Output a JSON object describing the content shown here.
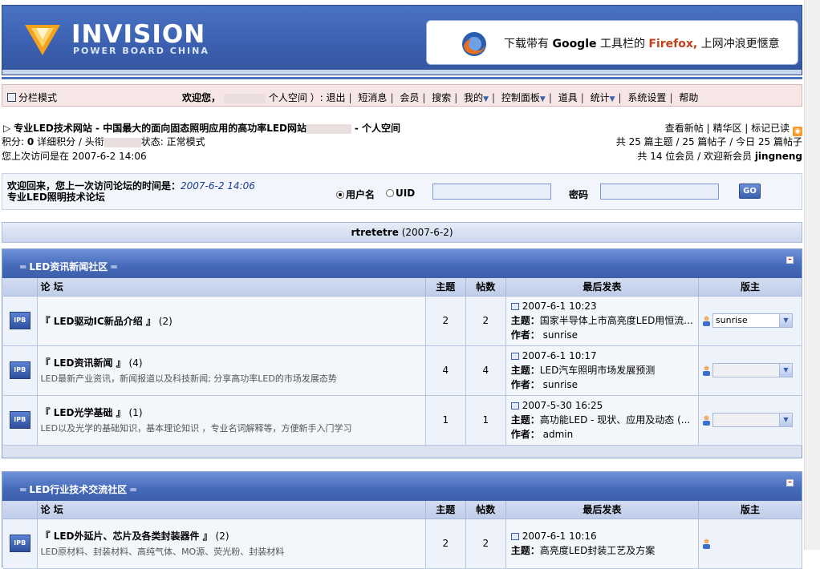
{
  "header": {
    "logo_title": "INVISION",
    "logo_sub": "POWER BOARD CHINA",
    "banner": {
      "pre": "下载带有 ",
      "google": "Google",
      "mid": " 工具栏的 ",
      "firefox": "Firefox,",
      "post": " 上网冲浪更惬意"
    }
  },
  "userbar": {
    "view_mode": "分栏模式",
    "welcome": "欢迎您，",
    "space": "个人空间 ）:",
    "links": [
      "退出",
      "短消息",
      "会员",
      "搜索",
      "我的",
      "控制面板",
      "道具",
      "统计",
      "系统设置",
      "帮助"
    ]
  },
  "info": {
    "site_title": "专业LED技术网站 - 中国最大的面向固态照明应用的高功率LED网站",
    "site_suffix": "- 个人空间",
    "points": "积分:",
    "points_val": "0",
    "points_rest": "详细积分 / 头衔",
    "status": "状态: 正常模式",
    "last_visit": "您上次访问是在 2007-6-2 14:06",
    "right_links": [
      "查看新帖",
      "精华区",
      "标记已读"
    ],
    "stats": "共 25 篇主题 / 25 篇帖子 / 今日 25 篇帖子",
    "members": "共 14 位会员 / 欢迎新会员",
    "new_member": "jingneng"
  },
  "login": {
    "welcome": "欢迎回来，您上一次访问论坛的时间是：",
    "time": "2007-6-2 14:06",
    "forum_name": "专业LED照明技术论坛",
    "radio_user": "用户名",
    "radio_uid": "UID",
    "password_label": "密码",
    "go": "GO"
  },
  "userline": {
    "name": "rtretetre",
    "date": "(2007-6-2)"
  },
  "columns": {
    "forum": "论  坛",
    "topics": "主题",
    "posts": "帖数",
    "last": "最后发表",
    "mod": "版主"
  },
  "labels": {
    "subject": "主题：",
    "author": "作者："
  },
  "categories": [
    {
      "title": "LED资讯新闻社区",
      "forums": [
        {
          "name": "『 LED驱动IC新品介绍 』",
          "count": "(2)",
          "desc": "",
          "topics": "2",
          "posts": "2",
          "last_time": "2007-6-1 10:23",
          "last_subject": "国家半导体上市高亮度LED用恒流...",
          "last_author": "sunrise",
          "mod": "sunrise"
        },
        {
          "name": "『 LED资讯新闻 』",
          "count": "(4)",
          "desc": "LED最新产业资讯，新闻报道以及科技新闻; 分享高功率LED的市场发展态势",
          "topics": "4",
          "posts": "4",
          "last_time": "2007-6-1 10:17",
          "last_subject": "LED汽车照明市场发展预测",
          "last_author": "sunrise",
          "mod": ""
        },
        {
          "name": "『 LED光学基础 』",
          "count": "(1)",
          "desc": "LED以及光学的基础知识，基本理论知识 ，专业名词解释等，方便新手入门学习",
          "topics": "1",
          "posts": "1",
          "last_time": "2007-5-30 16:25",
          "last_subject": "高功能LED - 现状、应用及动态 (...",
          "last_author": "admin",
          "mod": ""
        }
      ]
    },
    {
      "title": "LED行业技术交流社区",
      "forums": [
        {
          "name": "『 LED外延片、芯片及各类封装器件 』",
          "count": "(2)",
          "desc": "LED原材料、封装材料、高纯气体、MO源、荧光粉、封装材料",
          "topics": "2",
          "posts": "2",
          "last_time": "2007-6-1 10:16",
          "last_subject": "高亮度LED封装工艺及方案",
          "last_author": "",
          "mod": ""
        }
      ]
    }
  ]
}
